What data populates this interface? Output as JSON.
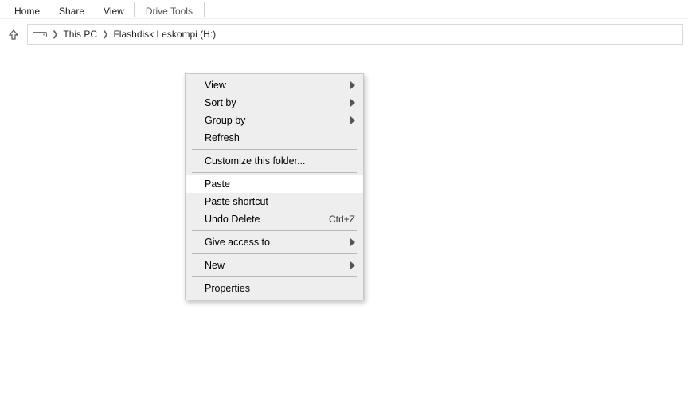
{
  "ribbon": {
    "tabs": [
      "Home",
      "Share",
      "View"
    ],
    "tools_label": "Drive Tools"
  },
  "breadcrumb": {
    "items": [
      "This PC",
      "Flashdisk Leskompi (H:)"
    ]
  },
  "context_menu": {
    "view": "View",
    "sort_by": "Sort by",
    "group_by": "Group by",
    "refresh": "Refresh",
    "customize": "Customize this folder...",
    "paste": "Paste",
    "paste_shortcut": "Paste shortcut",
    "undo_delete": {
      "label": "Undo Delete",
      "shortcut": "Ctrl+Z"
    },
    "give_access": "Give access to",
    "new": "New",
    "properties": "Properties"
  }
}
